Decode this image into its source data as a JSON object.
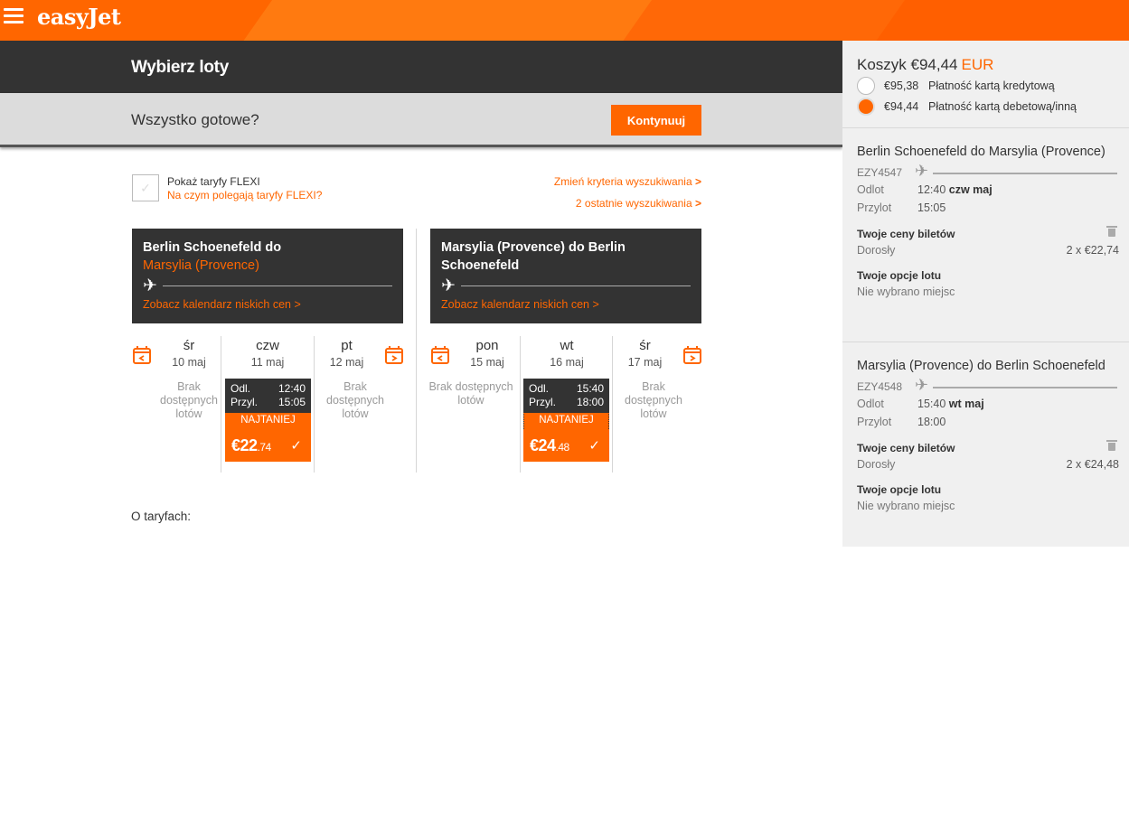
{
  "header": {
    "logo": "easyJet"
  },
  "title": "Wybierz loty",
  "ready": {
    "question": "Wszystko gotowe?",
    "continue_label": "Kontynuuj"
  },
  "options": {
    "flexi_label": "Pokaż taryfy FLEXI",
    "flexi_link": "Na czym polegają taryfy FLEXI?",
    "change_criteria": "Zmień kryteria wyszukiwania",
    "recent_searches": "2 ostatnie wyszukiwania",
    "chevron": ">"
  },
  "outbound": {
    "origin": "Berlin Schoenefeld do",
    "destination": "Marsylia (Provence)",
    "calendar_link": "Zobacz kalendarz niskich cen >",
    "days": [
      {
        "name": "śr",
        "date": "10 maj",
        "no_flights": "Brak dostępnych lotów"
      },
      {
        "name": "czw",
        "date": "11 maj"
      },
      {
        "name": "pt",
        "date": "12 maj",
        "no_flights": "Brak dostępnych lotów"
      }
    ],
    "flight": {
      "dep_label": "Odl.",
      "dep": "12:40",
      "arr_label": "Przyl.",
      "arr": "15:05",
      "badge": "NAJTANIEJ",
      "price_main": "€22",
      "price_cents": ".74",
      "tick": "✓"
    }
  },
  "inbound": {
    "origin": "Marsylia (Provence) do Berlin Schoenefeld",
    "calendar_link": "Zobacz kalendarz niskich cen >",
    "days": [
      {
        "name": "pon",
        "date": "15 maj",
        "no_flights": "Brak dostępnych lotów"
      },
      {
        "name": "wt",
        "date": "16 maj"
      },
      {
        "name": "śr",
        "date": "17 maj",
        "no_flights": "Brak dostępnych lotów"
      }
    ],
    "flight": {
      "dep_label": "Odl.",
      "dep": "15:40",
      "arr_label": "Przyl.",
      "arr": "18:00",
      "badge": "NAJTANIEJ",
      "price_main": "€24",
      "price_cents": ".48",
      "tick": "✓"
    }
  },
  "fares_heading": "O taryfach:",
  "basket": {
    "label": "Koszyk €94,44",
    "currency": "EUR",
    "payment_options": [
      {
        "amount": "€95,38",
        "label": "Płatność kartą kredytową",
        "selected": false
      },
      {
        "amount": "€94,44",
        "label": "Płatność kartą debetową/inną",
        "selected": true
      }
    ],
    "legs": [
      {
        "title": "Berlin Schoenefeld do Marsylia (Provence)",
        "flight_no": "EZY4547",
        "dep_label": "Odlot",
        "dep_time": "12:40",
        "dep_day": "czw maj",
        "arr_label": "Przylot",
        "arr_time": "15:05",
        "prices_heading": "Twoje ceny biletów",
        "pax_label": "Dorosły",
        "pax_price": "2 x €22,74",
        "options_heading": "Twoje opcje lotu",
        "options_value": "Nie wybrano miejsc"
      },
      {
        "title": "Marsylia (Provence) do Berlin Schoenefeld",
        "flight_no": "EZY4548",
        "dep_label": "Odlot",
        "dep_time": "15:40",
        "dep_day": "wt maj",
        "arr_label": "Przylot",
        "arr_time": "18:00",
        "prices_heading": "Twoje ceny biletów",
        "pax_label": "Dorosły",
        "pax_price": "2 x €24,48",
        "options_heading": "Twoje opcje lotu",
        "options_value": "Nie wybrano miejsc"
      }
    ]
  },
  "colors": {
    "brand": "#ff6600",
    "dark": "#333333",
    "panel": "#f0f0f0"
  }
}
